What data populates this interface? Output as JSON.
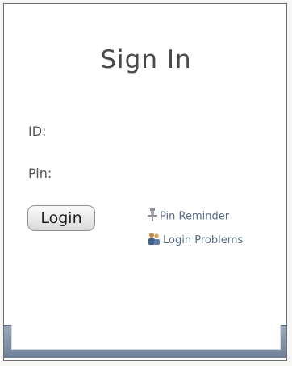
{
  "form": {
    "title": "Sign In",
    "id_label": "ID:",
    "pin_label": "Pin:",
    "login_label": "Login"
  },
  "links": {
    "pin_reminder": "Pin Reminder",
    "login_problems": "Login Problems"
  },
  "icons": {
    "pin_reminder": "pushpin-icon",
    "login_problems": "users-icon"
  },
  "colors": {
    "footer": "#7f8fa3",
    "link": "#5a6b86"
  }
}
